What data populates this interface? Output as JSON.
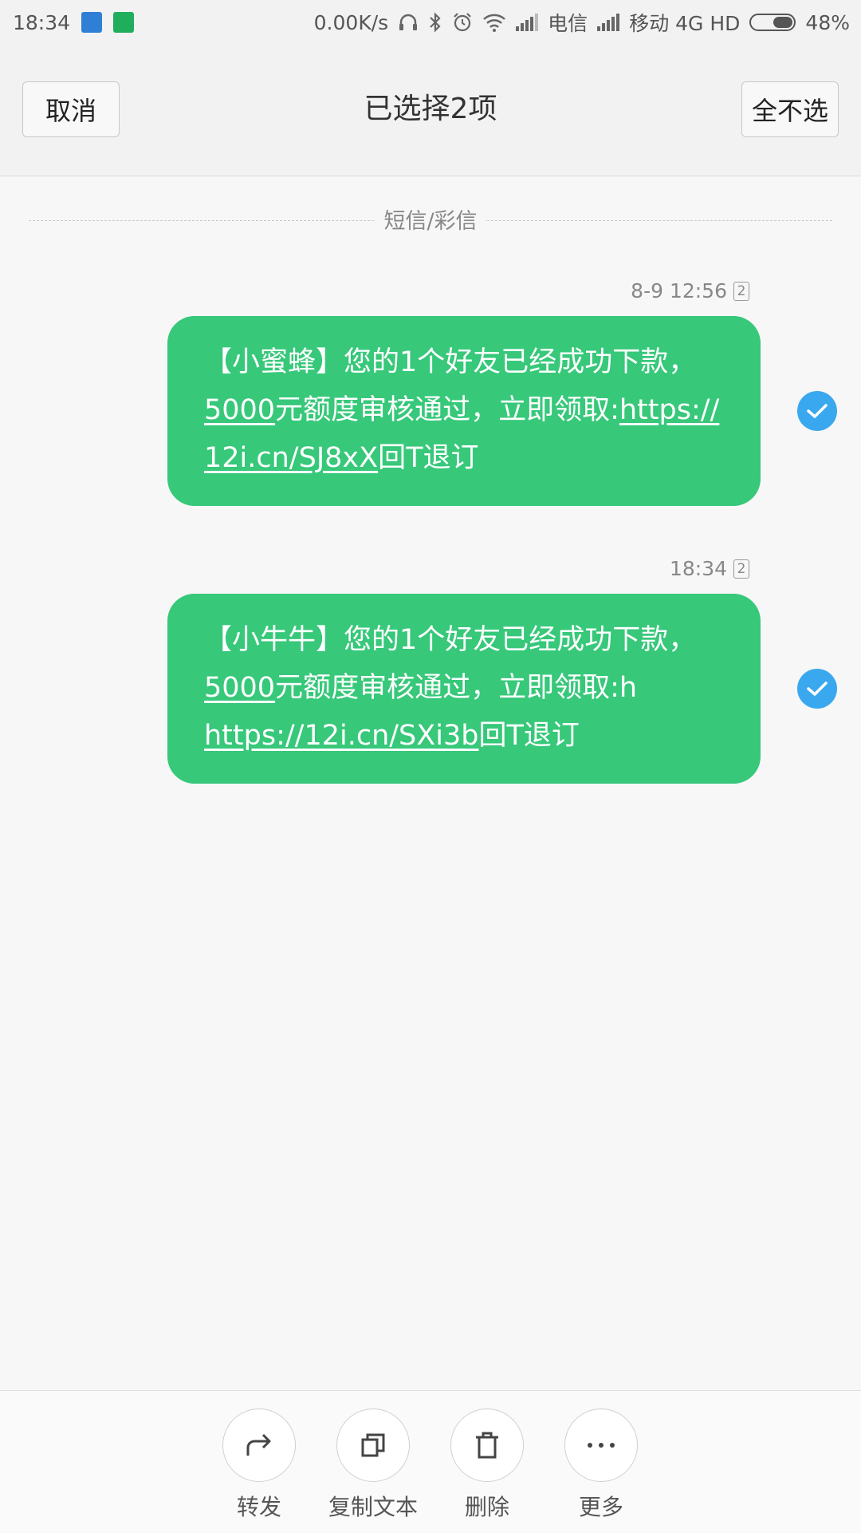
{
  "status_bar": {
    "time": "18:34",
    "net_speed": "0.00K/s",
    "carrier1": "电信",
    "carrier2": "移动 4G HD",
    "battery": "48%"
  },
  "header": {
    "cancel_label": "取消",
    "title": "已选择2项",
    "deselect_label": "全不选"
  },
  "thread": {
    "divider_label": "短信/彩信"
  },
  "messages": [
    {
      "time": "8-9 12:56",
      "sim": "2",
      "p1": "【小蜜蜂】您的1个好友已经成功下款，",
      "p2": "5000",
      "p3": "元额度审核通过，立即领取:",
      "p4": "https://",
      "p5": "12i.cn/SJ8xX",
      "p6": "回T退订"
    },
    {
      "time": "18:34",
      "sim": "2",
      "p1": "【小牛牛】您的1个好友已经成功下款，",
      "p2": "5000",
      "p3": "元额度审核通过，立即领取:h",
      "p4": "https://12i.cn/SXi3b",
      "p5": "回T退订"
    }
  ],
  "actions": {
    "forward": "转发",
    "copy": "复制文本",
    "delete": "删除",
    "more": "更多"
  },
  "colors": {
    "bubble": "#37c87a",
    "check": "#3aa8ee"
  }
}
